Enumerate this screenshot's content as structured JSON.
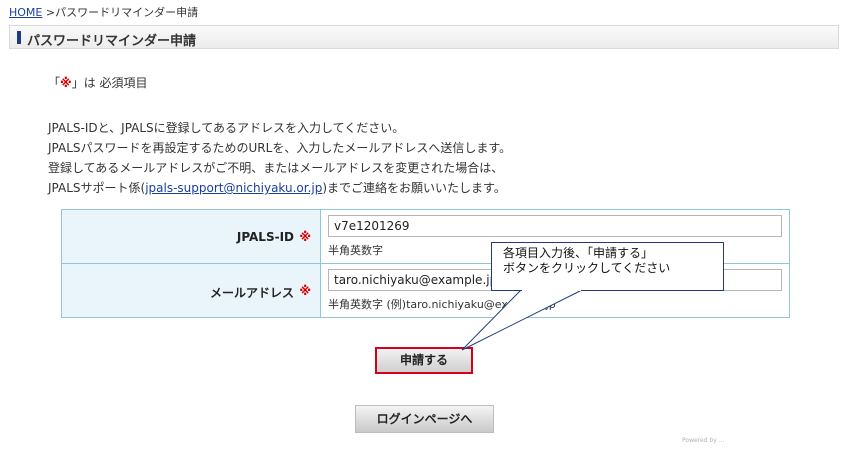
{
  "breadcrumb": {
    "home": "HOME",
    "separator": " >",
    "current": "パスワードリマインダー申請"
  },
  "page_title": "パスワードリマインダー申請",
  "required_note": {
    "open": "「",
    "mark": "※",
    "close": "」は 必須項目"
  },
  "instructions": {
    "line1": "JPALS-IDと、JPALSに登録してあるアドレスを入力してください。",
    "line2": "JPALSパスワードを再設定するためのURLを、入力したメールアドレスへ送信します。",
    "line3": "登録してあるメールアドレスがご不明、またはメールアドレスを変更された場合は、",
    "line4_prefix": "JPALSサポート係(",
    "support_email": "jpals-support@nichiyaku.or.jp",
    "line4_suffix": ")までご連絡をお願いいたします。"
  },
  "form": {
    "jpals_id": {
      "label": "JPALS-ID",
      "required_mark": "※",
      "value": "v7e1201269",
      "hint": "半角英数字"
    },
    "email": {
      "label": "メールアドレス",
      "required_mark": "※",
      "value": "taro.nichiyaku@example.jp",
      "hint": "半角英数字 (例)taro.nichiyaku@example.jp"
    }
  },
  "submit_label": "申請する",
  "login_label": "ログインページへ",
  "callout": {
    "line1": "各項目入力後、「申請する」",
    "line2": "ボタンをクリックしてください"
  },
  "footer_note": "Powered by ..."
}
